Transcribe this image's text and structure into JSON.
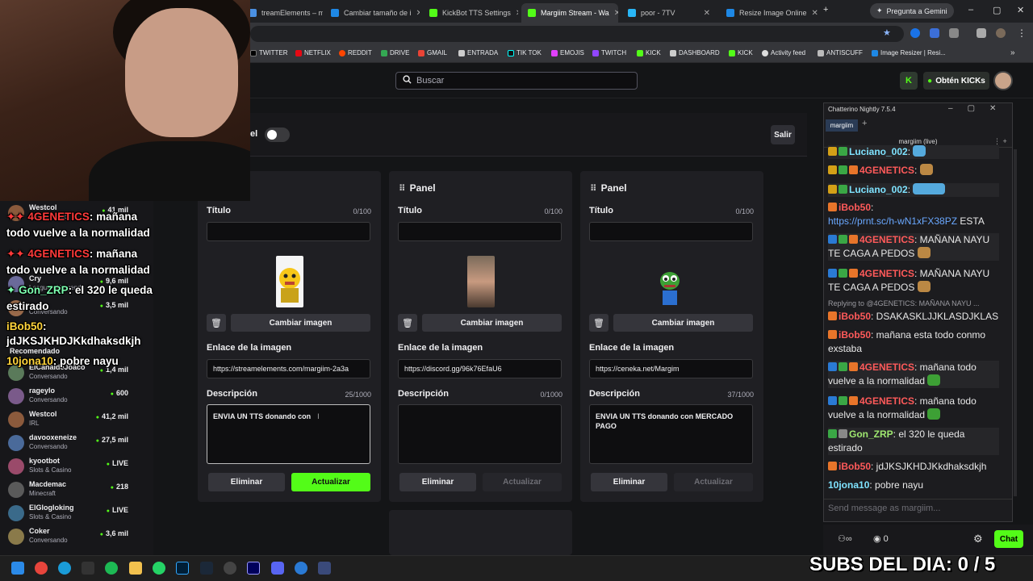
{
  "browser": {
    "tabs": [
      {
        "label": "treamElements – ma",
        "color": "#4a90e2"
      },
      {
        "label": "Cambiar tamaño de i",
        "color": "#1e88e5"
      },
      {
        "label": "KickBot TTS Settings",
        "color": "#53fc18"
      },
      {
        "label": "Margiim Stream - Wa",
        "color": "#53fc18"
      },
      {
        "label": "poor - 7TV",
        "color": "#29b6f6"
      },
      {
        "label": "Resize Image Online",
        "color": "#1e88e5"
      }
    ],
    "gemini_label": "Pregunta a Gemini",
    "bookmarks": [
      "TWITTER",
      "NETFLIX",
      "REDDIT",
      "DRIVE",
      "GMAIL",
      "ENTRADA",
      "TIK TOK",
      "EMOJIS",
      "TWITCH",
      "KICK",
      "DASHBOARD",
      "KICK",
      "Activity feed",
      "ANTISCUFF",
      "Image Resizer | Resi..."
    ]
  },
  "page": {
    "search_placeholder": "Buscar",
    "get_kicks": "Obtén KICKs",
    "toggle_label_tail": "el",
    "exit_label": "Salir"
  },
  "panels": [
    {
      "title": "",
      "title_label": "Título",
      "title_count": "0/100",
      "change_image": "Cambiar imagen",
      "link_label": "Enlace de la imagen",
      "link_value": "https://streamelements.com/margiim-2a3a",
      "desc_label": "Descripción",
      "desc_count": "25/1000",
      "desc_value": "ENVIA UN TTS donando con",
      "delete_label": "Eliminar",
      "update_label": "Actualizar"
    },
    {
      "title": "Panel",
      "title_label": "Título",
      "title_count": "0/100",
      "change_image": "Cambiar imagen",
      "link_label": "Enlace de la imagen",
      "link_value": "https://discord.gg/96k76EfaU6",
      "desc_label": "Descripción",
      "desc_count": "0/1000",
      "desc_value": "",
      "delete_label": "Eliminar",
      "update_label": "Actualizar"
    },
    {
      "title": "Panel",
      "title_label": "Título",
      "title_count": "0/100",
      "change_image": "Cambiar imagen",
      "link_label": "Enlace de la imagen",
      "link_value": "https://ceneka.net/Margim",
      "desc_label": "Descripción",
      "desc_count": "37/1000",
      "desc_value": "ENVIA UN TTS donando con MERCADO PAGO",
      "delete_label": "Eliminar",
      "update_label": "Actualizar"
    }
  ],
  "sidebar": {
    "items": [
      {
        "name": "Westcol",
        "cat": "Conversando",
        "viewers": "41 mil",
        "color": "#8b5a3c"
      },
      {
        "name": "Cry",
        "cat": "League of Legends",
        "viewers": "9,6 mil",
        "color": "#6a6a9a"
      },
      {
        "name": "",
        "cat": "Conversando",
        "viewers": "3,5 mil",
        "color": "#9a6a4a"
      },
      {
        "name": "ElCañaldeJoaco",
        "cat": "Conversando",
        "viewers": "1,4 mil",
        "color": "#5a7a5a"
      },
      {
        "name": "rageylo",
        "cat": "Conversando",
        "viewers": "600",
        "color": "#7a5a8a"
      },
      {
        "name": "Westcol",
        "cat": "IRL",
        "viewers": "41,2 mil",
        "color": "#8b5a3c"
      },
      {
        "name": "davooxeneize",
        "cat": "Conversando",
        "viewers": "27,5 mil",
        "color": "#4a6a9a"
      },
      {
        "name": "kyootbot",
        "cat": "Slots & Casino",
        "viewers": "LIVE",
        "color": "#9a4a6a"
      },
      {
        "name": "Macdemac",
        "cat": "Minecraft",
        "viewers": "218",
        "color": "#5a5a5a"
      },
      {
        "name": "ElGlogloking",
        "cat": "Slots & Casino",
        "viewers": "LIVE",
        "color": "#3a6a8a"
      },
      {
        "name": "Coker",
        "cat": "Conversando",
        "viewers": "3,6 mil",
        "color": "#8a7a4a"
      }
    ],
    "recomendado": "Recomendado"
  },
  "overlay_chat": [
    {
      "user": "4GENETICS",
      "text": ": mañana",
      "cont": "todo vuelve a la normalidad"
    },
    {
      "user": "4GENETICS",
      "text": ": mañana",
      "cont": "todo vuelve a la normalidad"
    },
    {
      "user": "Gon_ZRP",
      "text": ": el 320 le queda",
      "cont": "estirado"
    },
    {
      "user": "iBob50",
      "text": ":",
      "cont": "jdJKSJKHDJKkdhaksdkjh"
    },
    {
      "user": "10jona10",
      "text": ": pobre nayu",
      "cont": ""
    }
  ],
  "chatterino": {
    "title": "Chatterino Nightly 7.5.4",
    "tab": "margiim",
    "channel": "margiim (live)",
    "messages": [
      {
        "user": "Luciano_002",
        "text": ":"
      },
      {
        "user": "4GENETICS",
        "text": ":"
      },
      {
        "user": "Luciano_002",
        "text": ":"
      },
      {
        "user": "iBob50",
        "text": ":",
        "link": "https://prnt.sc/h-wN1xFX38PZ",
        "after": " ESTA"
      },
      {
        "user": "4GENETICS",
        "text": ": MAÑANA NAYU TE CAGA A PEDOS"
      },
      {
        "user": "4GENETICS",
        "text": ": MAÑANA NAYU TE CAGA A PEDOS"
      },
      {
        "user": "iBob50",
        "text": ": DSAKASKLJJKLASDJKLAS"
      },
      {
        "user": "iBob50",
        "text": ": mañana esta todo conmo exstaba"
      },
      {
        "user": "4GENETICS",
        "text": ": mañana todo vuelve a la normalidad"
      },
      {
        "user": "4GENETICS",
        "text": ": mañana todo vuelve a la normalidad"
      },
      {
        "user": "Gon_ZRP",
        "text": ": el 320 le queda estirado"
      },
      {
        "user": "iBob50",
        "text": ": jdJKSJKHDJKkdhaksdkjh"
      },
      {
        "user": "10jona10",
        "text": ": pobre nayu"
      }
    ],
    "replying": "Replying to @4GENETICS: MAÑANA NAYU ...",
    "input_placeholder": "Send message as margiim...",
    "chat_button": "Chat",
    "viewer_count": "0"
  },
  "subs_overlay": "SUBS DEL DIA: 0 / 5",
  "colors": {
    "accent": "#53fc18",
    "bg": "#0e0e10"
  }
}
